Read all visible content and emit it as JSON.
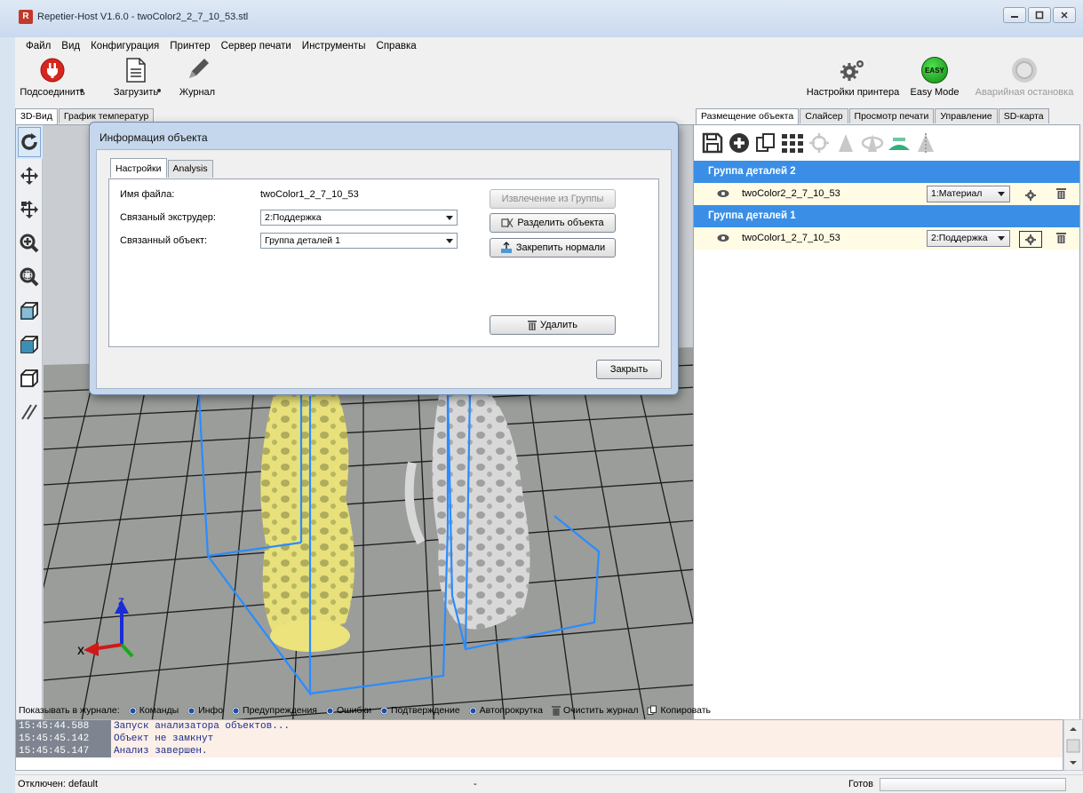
{
  "window": {
    "title": "Repetier-Host V1.6.0 - twoColor2_2_7_10_53.stl",
    "app_icon": "R"
  },
  "menu": [
    "Файл",
    "Вид",
    "Конфигурация",
    "Принтер",
    "Сервер печати",
    "Инструменты",
    "Справка"
  ],
  "toolbar": {
    "connect": "Подсоединить",
    "load": "Загрузить",
    "log": "Журнал",
    "printer_settings": "Настройки принтера",
    "easy_mode": "Easy Mode",
    "easy_badge": "EASY",
    "emergency_stop": "Аварийная остановка"
  },
  "left_tabs": [
    "3D-Вид",
    "График температур"
  ],
  "right_tabs": [
    "Размещение объекта",
    "Слайсер",
    "Просмотр печати",
    "Управление",
    "SD-карта"
  ],
  "dialog": {
    "title": "Информация объекта",
    "tabs": [
      "Настройки",
      "Analysis"
    ],
    "filename_label": "Имя файла:",
    "filename_value": "twoColor1_2_7_10_53",
    "extruder_label": "Связаный экструдер:",
    "extruder_value": "2:Поддержка",
    "object_label": "Связанный объект:",
    "object_value": "Группа деталей 1",
    "extract_button": "Извлечение из Группы",
    "split_button": "Разделить объекта",
    "fix_normals_button": "Закрепить нормали",
    "delete_button": "Удалить",
    "close_button": "Закрыть"
  },
  "object_list": {
    "groups": [
      {
        "name": "Группа деталей 2",
        "object": "twoColor2_2_7_10_53",
        "extruder": "1:Материал",
        "boxed": false
      },
      {
        "name": "Группа деталей 1",
        "object": "twoColor1_2_7_10_53",
        "extruder": "2:Поддержка",
        "boxed": true
      }
    ]
  },
  "log": {
    "show_label": "Показывать в журнале:",
    "options": [
      "Команды",
      "Инфо",
      "Предупреждения",
      "Ошибки",
      "Подтверждение",
      "Автопрокрутка"
    ],
    "clear": "Очистить журнал",
    "copy": "Копировать",
    "lines": [
      {
        "ts": "15:45:44.588",
        "msg": "Запуск анализатора объектов..."
      },
      {
        "ts": "15:45:45.142",
        "msg": "Объект не замкнут"
      },
      {
        "ts": "15:45:45.147",
        "msg": "Анализ завершен."
      }
    ]
  },
  "status": {
    "connection": "Отключен: default",
    "middle": "-",
    "ready": "Готов"
  },
  "colors": {
    "group_header": "#3a8ee6",
    "object_row": "#fffbe5",
    "bounding_box": "#2a8cff",
    "model_yellow": "#e8e07a",
    "model_white": "#d8d8d8"
  }
}
